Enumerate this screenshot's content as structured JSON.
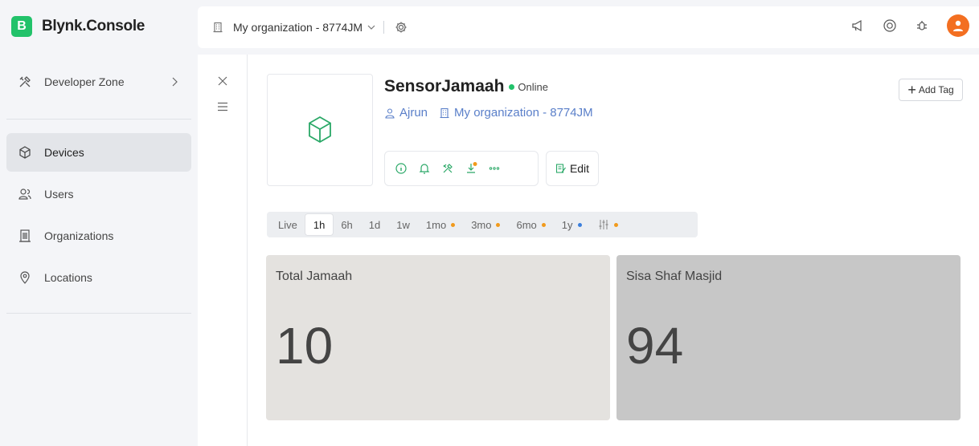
{
  "brand": {
    "logo_letter": "B",
    "name": "Blynk.Console",
    "color": "#22c26a"
  },
  "header": {
    "organization": "My organization - 8774JM",
    "icons": [
      "building-icon",
      "chevron-down-icon",
      "gear-icon",
      "megaphone-icon",
      "help-icon",
      "bug-icon",
      "avatar"
    ]
  },
  "sidebar": {
    "items": [
      {
        "label": "Developer Zone",
        "icon": "tools-icon"
      },
      {
        "label": "Devices",
        "icon": "cube-icon",
        "active": true
      },
      {
        "label": "Users",
        "icon": "users-icon"
      },
      {
        "label": "Organizations",
        "icon": "building-icon"
      },
      {
        "label": "Locations",
        "icon": "pin-icon"
      }
    ]
  },
  "device": {
    "name": "SensorJamaah",
    "status": "Online",
    "owner": "Ajrun",
    "organization": "My organization - 8774JM",
    "edit_label": "Edit",
    "add_tag_label": "Add Tag"
  },
  "time_tabs": [
    {
      "label": "Live"
    },
    {
      "label": "1h",
      "active": true
    },
    {
      "label": "6h"
    },
    {
      "label": "1d"
    },
    {
      "label": "1w"
    },
    {
      "label": "1mo",
      "dot": "orange"
    },
    {
      "label": "3mo",
      "dot": "orange"
    },
    {
      "label": "6mo",
      "dot": "orange"
    },
    {
      "label": "1y",
      "dot": "blue"
    },
    {
      "label": "",
      "icon": "sliders-icon",
      "dot": "orange"
    }
  ],
  "widgets": [
    {
      "label": "Total Jamaah",
      "value": "10"
    },
    {
      "label": "Sisa Shaf Masjid",
      "value": "94"
    }
  ]
}
